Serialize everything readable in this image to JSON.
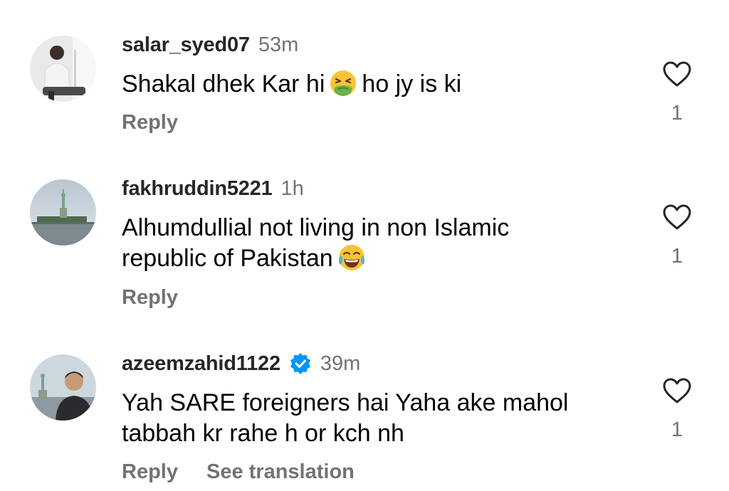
{
  "comments": [
    {
      "username": "salar_syed07",
      "time": "53m",
      "verified": false,
      "text_before": "Shakal dhek Kar hi",
      "emoji": "nauseated-face",
      "text_after": "ho jy is ki",
      "reply": "Reply",
      "likes": "1"
    },
    {
      "username": "fakhruddin5221",
      "time": "1h",
      "verified": false,
      "text_line1": "Alhumdullial not living in non Islamic",
      "text_line2": "republic of Pakistan",
      "emoji": "face-with-tears-of-joy",
      "reply": "Reply",
      "likes": "1"
    },
    {
      "username": "azeemzahid1122",
      "time": "39m",
      "verified": true,
      "text_line1": "Yah SARE foreigners hai Yaha ake mahol",
      "text_line2": "tabbah kr rahe h or kch nh",
      "reply": "Reply",
      "see_translation": "See translation",
      "likes": "1"
    }
  ],
  "icons": {
    "like": "heart-outline-icon",
    "verified": "verified-badge-icon"
  },
  "colors": {
    "username": "#262626",
    "meta": "#737373",
    "text": "#000000",
    "verified": "#0095f6"
  }
}
